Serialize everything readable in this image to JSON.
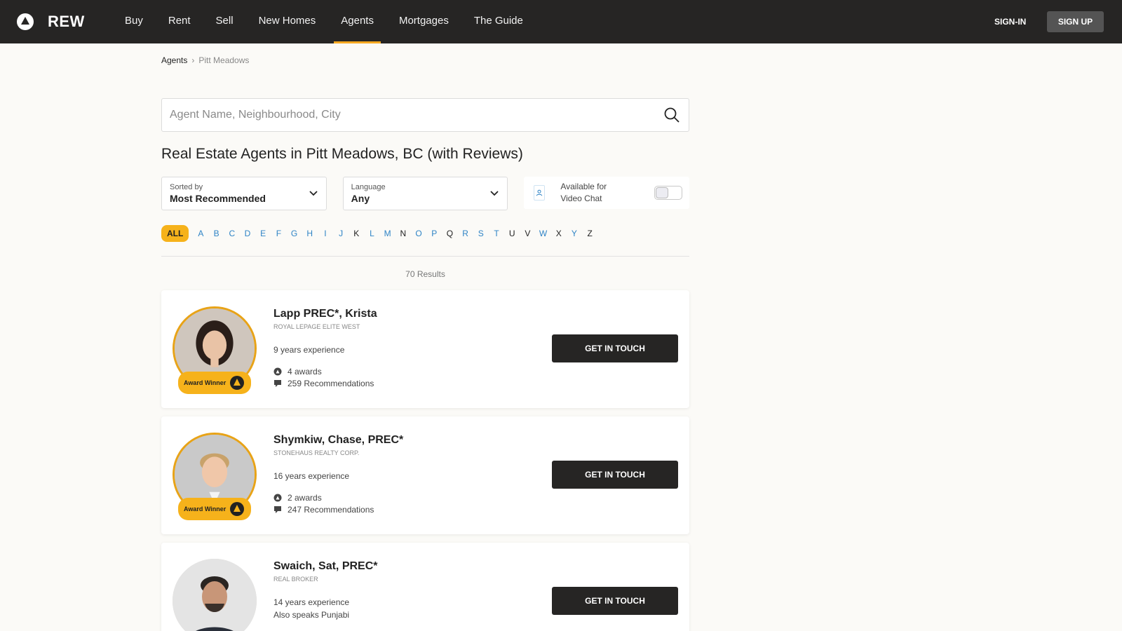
{
  "brand": {
    "logo_text": "REW",
    "accent": "#f6b21b",
    "nav_bg": "#262524"
  },
  "nav": {
    "links": [
      {
        "label": "Buy"
      },
      {
        "label": "Rent"
      },
      {
        "label": "Sell"
      },
      {
        "label": "New Homes"
      },
      {
        "label": "Agents"
      },
      {
        "label": "Mortgages"
      },
      {
        "label": "The Guide"
      }
    ],
    "active": "Agents",
    "signin": "SIGN-IN",
    "signup": "SIGN UP"
  },
  "breadcrumb": {
    "root": "Agents",
    "current": "Pitt Meadows"
  },
  "search": {
    "placeholder": "Agent Name, Neighbourhood, City"
  },
  "page_title": "Real Estate Agents in Pitt Meadows, BC (with Reviews)",
  "filters": {
    "sort": {
      "label": "Sorted by",
      "value": "Most Recommended"
    },
    "language": {
      "label": "Language",
      "value": "Any"
    },
    "video_chat": {
      "line1": "Available for",
      "line2": "Video Chat",
      "enabled": false
    }
  },
  "alphabet": {
    "all": "ALL",
    "letters": [
      {
        "l": "A",
        "link": true
      },
      {
        "l": "B",
        "link": true
      },
      {
        "l": "C",
        "link": true
      },
      {
        "l": "D",
        "link": true
      },
      {
        "l": "E",
        "link": true
      },
      {
        "l": "F",
        "link": true
      },
      {
        "l": "G",
        "link": true
      },
      {
        "l": "H",
        "link": true
      },
      {
        "l": "I",
        "link": true
      },
      {
        "l": "J",
        "link": true
      },
      {
        "l": "K",
        "link": false
      },
      {
        "l": "L",
        "link": true
      },
      {
        "l": "M",
        "link": true
      },
      {
        "l": "N",
        "link": false
      },
      {
        "l": "O",
        "link": true
      },
      {
        "l": "P",
        "link": true
      },
      {
        "l": "Q",
        "link": false
      },
      {
        "l": "R",
        "link": true
      },
      {
        "l": "S",
        "link": true
      },
      {
        "l": "T",
        "link": true
      },
      {
        "l": "U",
        "link": false
      },
      {
        "l": "V",
        "link": false
      },
      {
        "l": "W",
        "link": true
      },
      {
        "l": "X",
        "link": false
      },
      {
        "l": "Y",
        "link": true
      },
      {
        "l": "Z",
        "link": false
      }
    ]
  },
  "results": "70 Results",
  "agents": [
    {
      "name": "Lapp PREC*, Krista",
      "brokerage": "ROYAL LEPAGE ELITE WEST",
      "experience": "9 years experience",
      "awards": "4 awards",
      "recommendations": "259 Recommendations",
      "badge": "Award Winner",
      "cta": "GET IN TOUCH"
    },
    {
      "name": "Shymkiw, Chase, PREC*",
      "brokerage": "STONEHAUS REALTY CORP.",
      "experience": "16 years experience",
      "awards": "2 awards",
      "recommendations": "247 Recommendations",
      "badge": "Award Winner",
      "cta": "GET IN TOUCH"
    },
    {
      "name": "Swaich, Sat, PREC*",
      "brokerage": "REAL BROKER",
      "experience": "14 years experience",
      "speaks": "Also speaks Punjabi",
      "cta": "GET IN TOUCH"
    }
  ]
}
